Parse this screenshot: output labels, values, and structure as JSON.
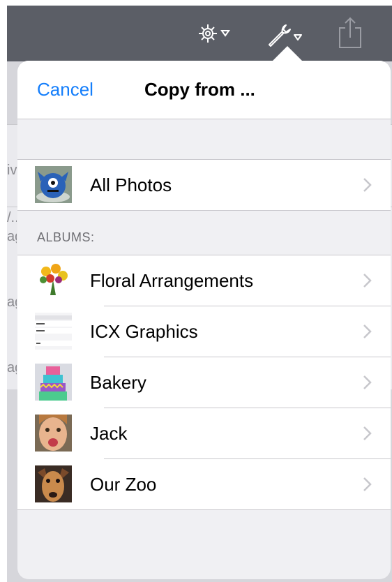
{
  "toolbar": {
    "icons": [
      "gear-icon",
      "wrench-icon",
      "share-icon"
    ],
    "bar_color": "#5b5e66"
  },
  "background": {
    "fragments": [
      "iv",
      "/..",
      "ag",
      "ag",
      "ag"
    ]
  },
  "popover": {
    "cancel_label": "Cancel",
    "title": "Copy from ...",
    "accent_color": "#147efb",
    "all_photos": {
      "label": "All Photos",
      "thumb": "monster-cake-thumbnail"
    },
    "albums_header": "ALBUMS:",
    "albums": [
      {
        "label": "Floral Arrangements",
        "thumb": "flower-bouquet-thumbnail"
      },
      {
        "label": "ICX Graphics",
        "thumb": "settings-screenshot-thumbnail"
      },
      {
        "label": "Bakery",
        "thumb": "layer-cake-thumbnail"
      },
      {
        "label": "Jack",
        "thumb": "child-photo-thumbnail"
      },
      {
        "label": "Our Zoo",
        "thumb": "dog-photo-thumbnail"
      }
    ]
  }
}
